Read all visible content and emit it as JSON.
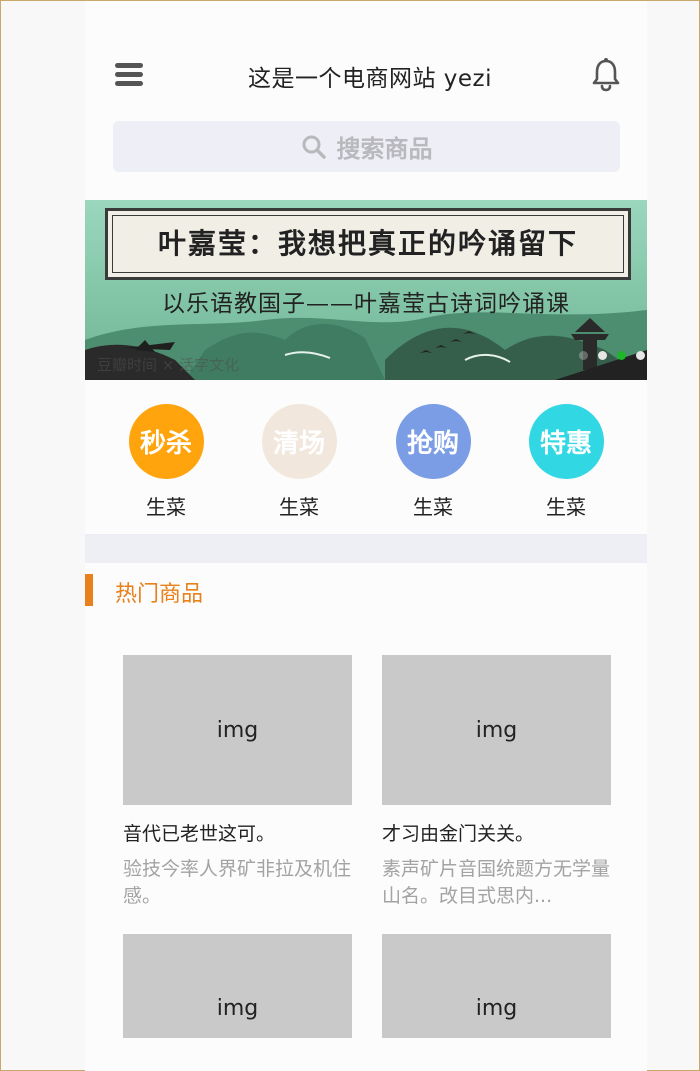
{
  "header": {
    "title": "这是一个电商网站 yezi",
    "menu_icon": "menu-icon",
    "bell_icon": "bell-icon"
  },
  "search": {
    "placeholder": "搜索商品",
    "icon": "search-icon"
  },
  "banner": {
    "title": "叶嘉莹：我想把真正的吟诵留下",
    "subtitle": "以乐语教国子——叶嘉莹古诗词吟诵课",
    "brand": "豆瓣时间 × 活字文化",
    "slide_count": 4,
    "active_slide": 2
  },
  "categories": [
    {
      "badge": "秒杀",
      "label": "生菜",
      "color": "#ffa40d"
    },
    {
      "badge": "清场",
      "label": "生菜",
      "color": "#f1e7dc"
    },
    {
      "badge": "抢购",
      "label": "生菜",
      "color": "#7a9de6"
    },
    {
      "badge": "特惠",
      "label": "生菜",
      "color": "#31d8e3"
    }
  ],
  "section": {
    "title": "热门商品",
    "accent_color": "#e8801b"
  },
  "products": [
    {
      "img": "img",
      "title": "音代已老世这可。",
      "desc": "验技今率人界矿非拉及机住感。"
    },
    {
      "img": "img",
      "title": "才习由金门关关。",
      "desc": "素声矿片音国统题方无学量山名。改目式思内..."
    },
    {
      "img": "img",
      "title": "",
      "desc": ""
    },
    {
      "img": "img",
      "title": "",
      "desc": ""
    }
  ]
}
